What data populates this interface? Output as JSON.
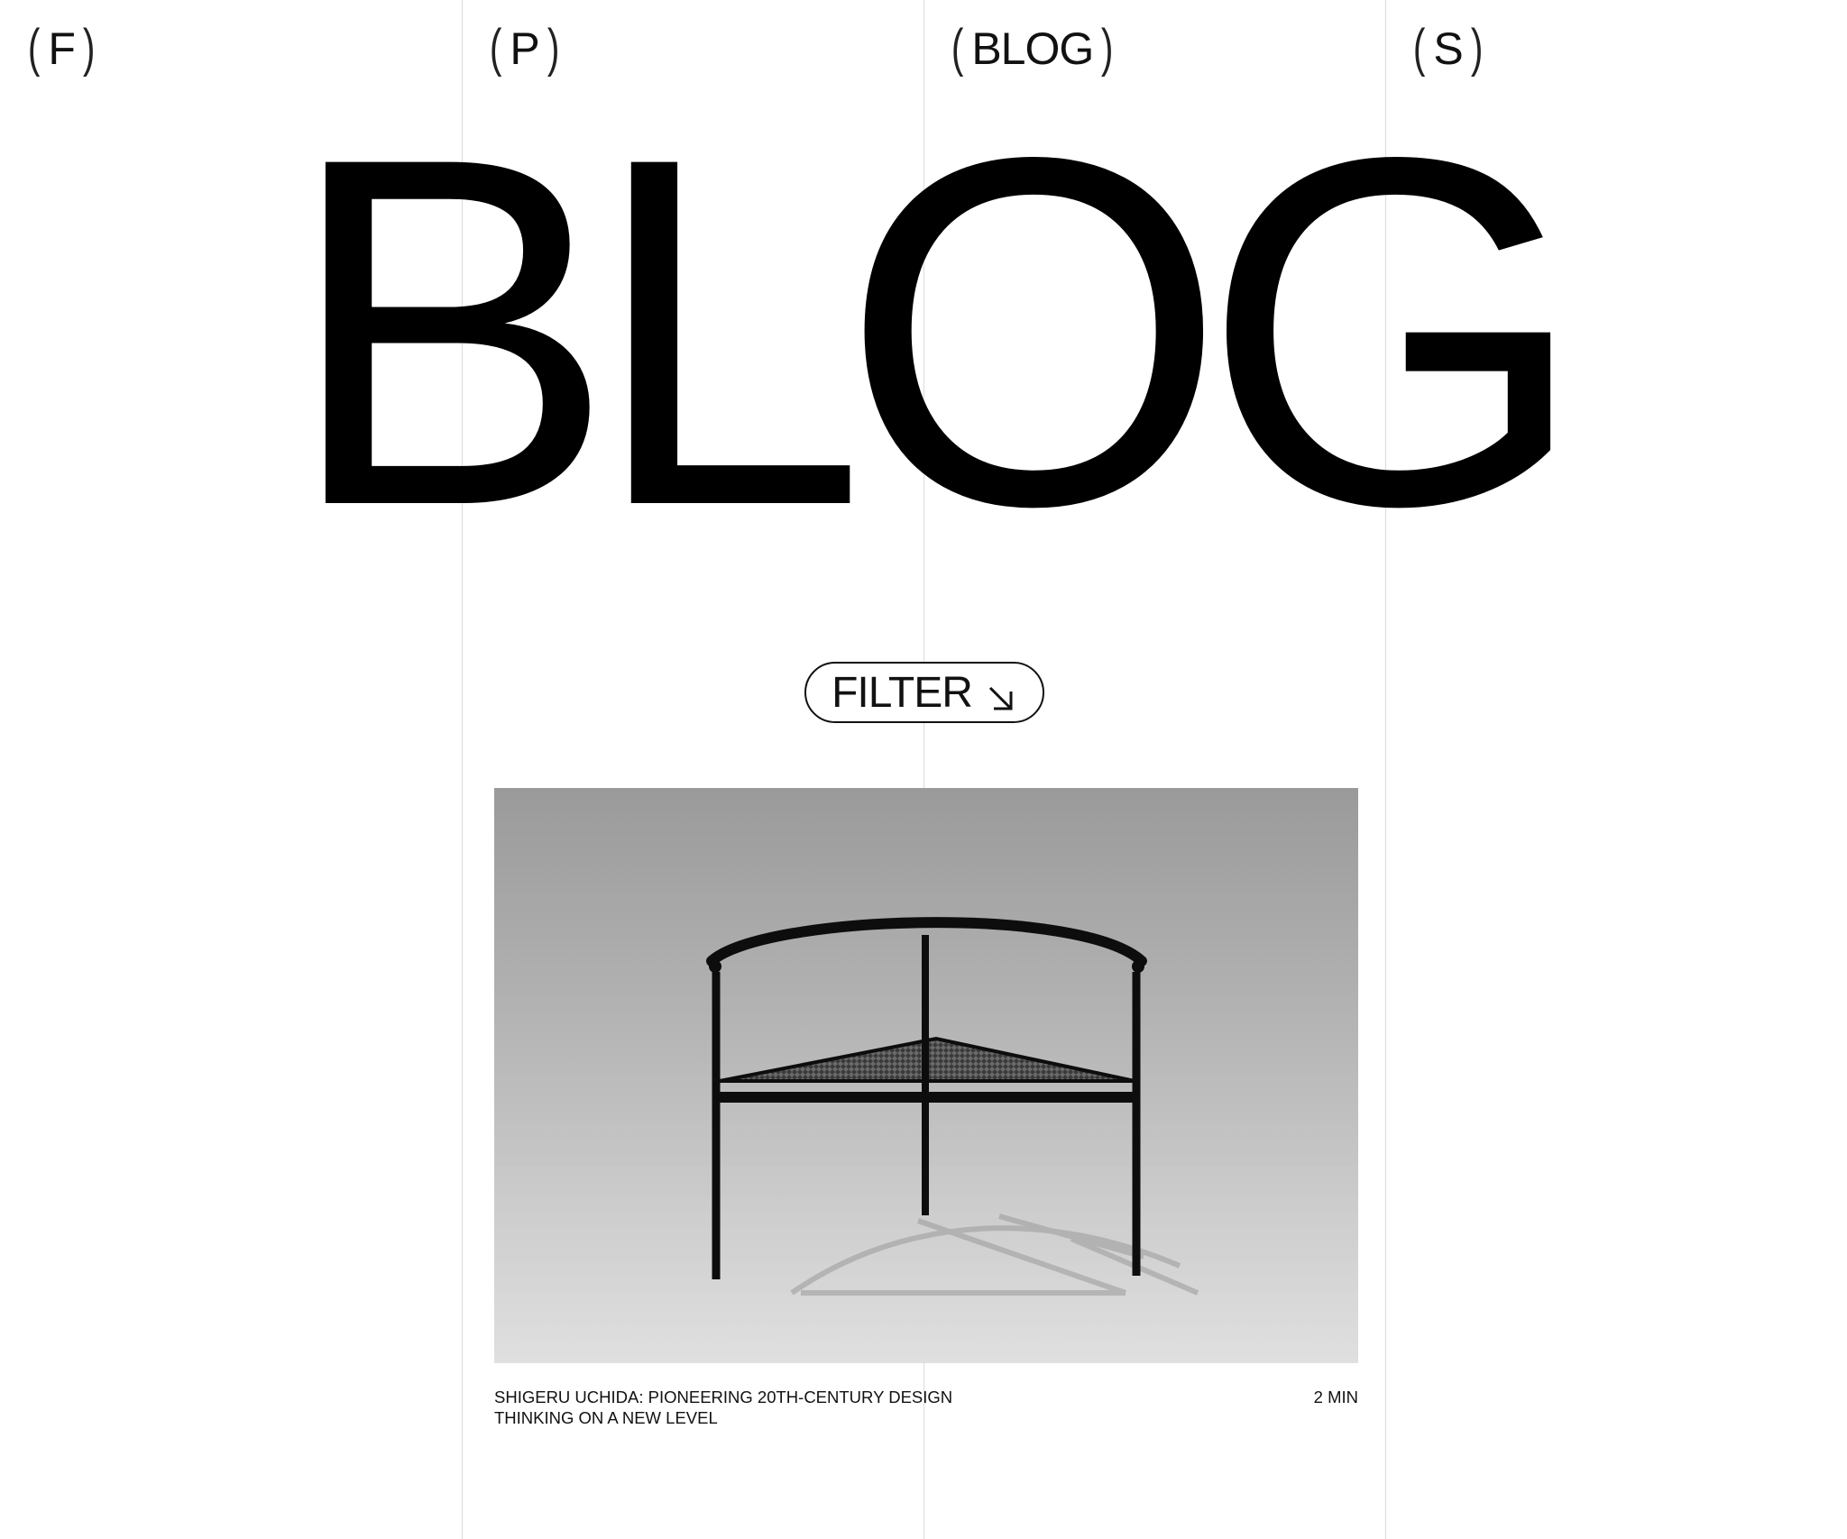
{
  "nav": {
    "items": [
      {
        "label": "F"
      },
      {
        "label": "P"
      },
      {
        "label": "BLOG"
      },
      {
        "label": "S"
      }
    ]
  },
  "hero": {
    "title": "BLOG"
  },
  "filter": {
    "label": "FILTER",
    "icon": "arrow-down-right-icon"
  },
  "posts": [
    {
      "title_line1": "SHIGERU UCHIDA: PIONEERING 20TH-CENTURY DESIGN",
      "title_line2": "THINKING ON A NEW LEVEL",
      "read_time": "2 MIN",
      "image_subject": "black tubular steel chair with mesh triangular seat"
    }
  ],
  "colors": {
    "background": "#ffffff",
    "text": "#111111",
    "grid_line": "#dcdcdc"
  }
}
